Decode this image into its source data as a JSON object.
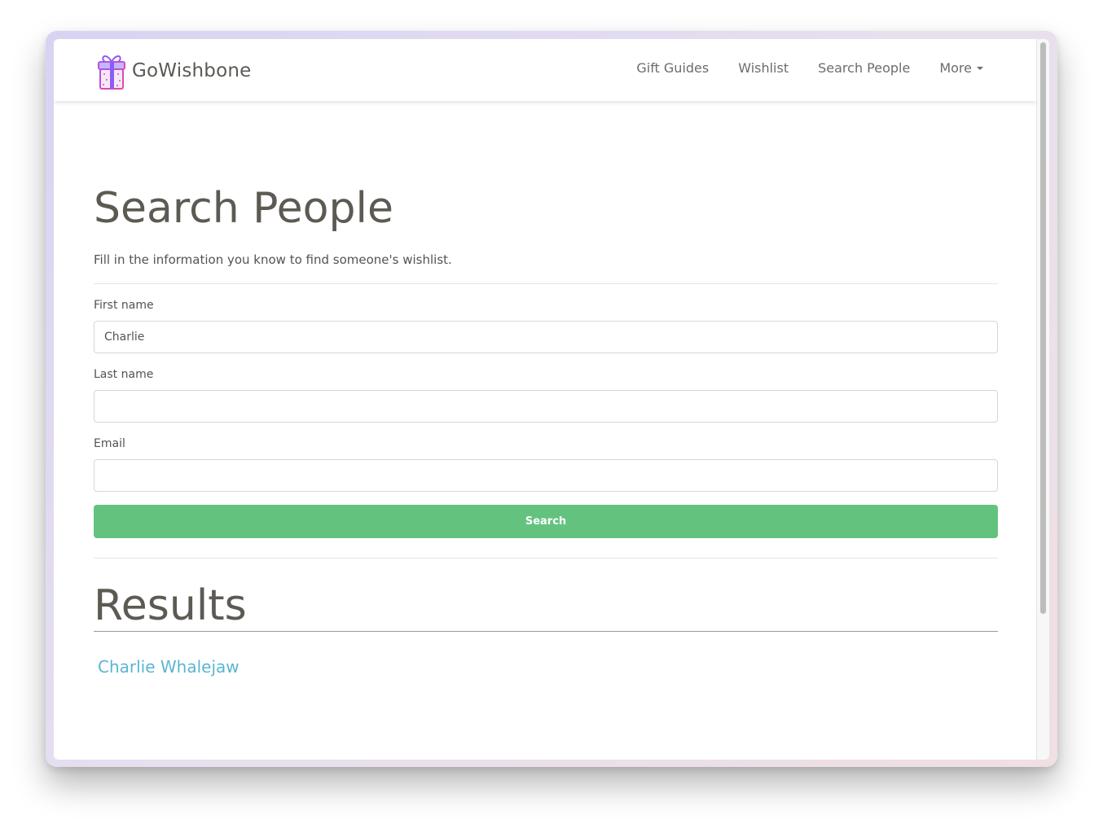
{
  "brand": {
    "name": "GoWishbone",
    "logo_icon": "gift-box-icon"
  },
  "nav": {
    "items": [
      {
        "label": "Gift Guides"
      },
      {
        "label": "Wishlist"
      },
      {
        "label": "Search People"
      },
      {
        "label": "More"
      }
    ]
  },
  "page": {
    "title": "Search People",
    "description": "Fill in the information you know to find someone's wishlist."
  },
  "form": {
    "first_name": {
      "label": "First name",
      "value": "Charlie"
    },
    "last_name": {
      "label": "Last name",
      "value": ""
    },
    "email": {
      "label": "Email",
      "value": ""
    },
    "submit_label": "Search"
  },
  "results": {
    "title": "Results",
    "items": [
      {
        "name": "Charlie Whalejaw"
      }
    ]
  },
  "colors": {
    "button_green": "#63c37e",
    "link_blue": "#5bb5d2",
    "heading_gray": "#5c5a52",
    "logo_purple": "#a855f7"
  }
}
